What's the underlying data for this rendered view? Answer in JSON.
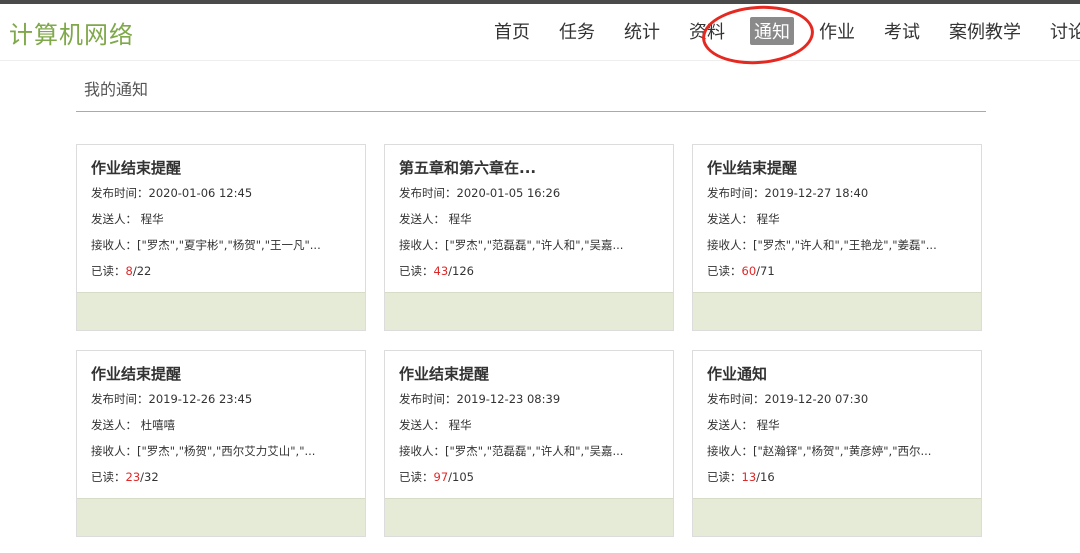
{
  "app": {
    "title": "计算机网络"
  },
  "nav": {
    "items": [
      "首页",
      "任务",
      "统计",
      "资料",
      "通知",
      "作业",
      "考试",
      "案例教学",
      "讨论"
    ],
    "active_index": 4
  },
  "page": {
    "section_title": "我的通知"
  },
  "labels": {
    "time": "发布时间：",
    "sender": "发送人：",
    "receiver": "接收人：",
    "read": "已读："
  },
  "notices": [
    {
      "title": "作业结束提醒",
      "time": "2020-01-06 12:45",
      "sender": "程华",
      "receivers": "[\"罗杰\",\"夏宇彬\",\"杨贺\",\"王一凡\"...",
      "read": "8",
      "total": "/22"
    },
    {
      "title": "第五章和第六章在...",
      "time": "2020-01-05 16:26",
      "sender": "程华",
      "receivers": "[\"罗杰\",\"范磊磊\",\"许人和\",\"吴嘉...",
      "read": "43",
      "total": "/126"
    },
    {
      "title": "作业结束提醒",
      "time": "2019-12-27 18:40",
      "sender": "程华",
      "receivers": "[\"罗杰\",\"许人和\",\"王艳龙\",\"姜磊\"...",
      "read": "60",
      "total": "/71"
    },
    {
      "title": "作业结束提醒",
      "time": "2019-12-26 23:45",
      "sender": "杜嘻嘻",
      "receivers": "[\"罗杰\",\"杨贺\",\"西尔艾力艾山\",\"...",
      "read": "23",
      "total": "/32"
    },
    {
      "title": "作业结束提醒",
      "time": "2019-12-23 08:39",
      "sender": "程华",
      "receivers": "[\"罗杰\",\"范磊磊\",\"许人和\",\"吴嘉...",
      "read": "97",
      "total": "/105"
    },
    {
      "title": "作业通知",
      "time": "2019-12-20 07:30",
      "sender": "程华",
      "receivers": "[\"赵瀚铎\",\"杨贺\",\"黄彦婷\",\"西尔...",
      "read": "13",
      "total": "/16"
    }
  ],
  "colors": {
    "brand": "#7fa84a",
    "active_nav_bg": "#8a8a8a",
    "read_count": "#e02828",
    "card_footer": "#e6ebd8",
    "annotation": "#e52820"
  }
}
